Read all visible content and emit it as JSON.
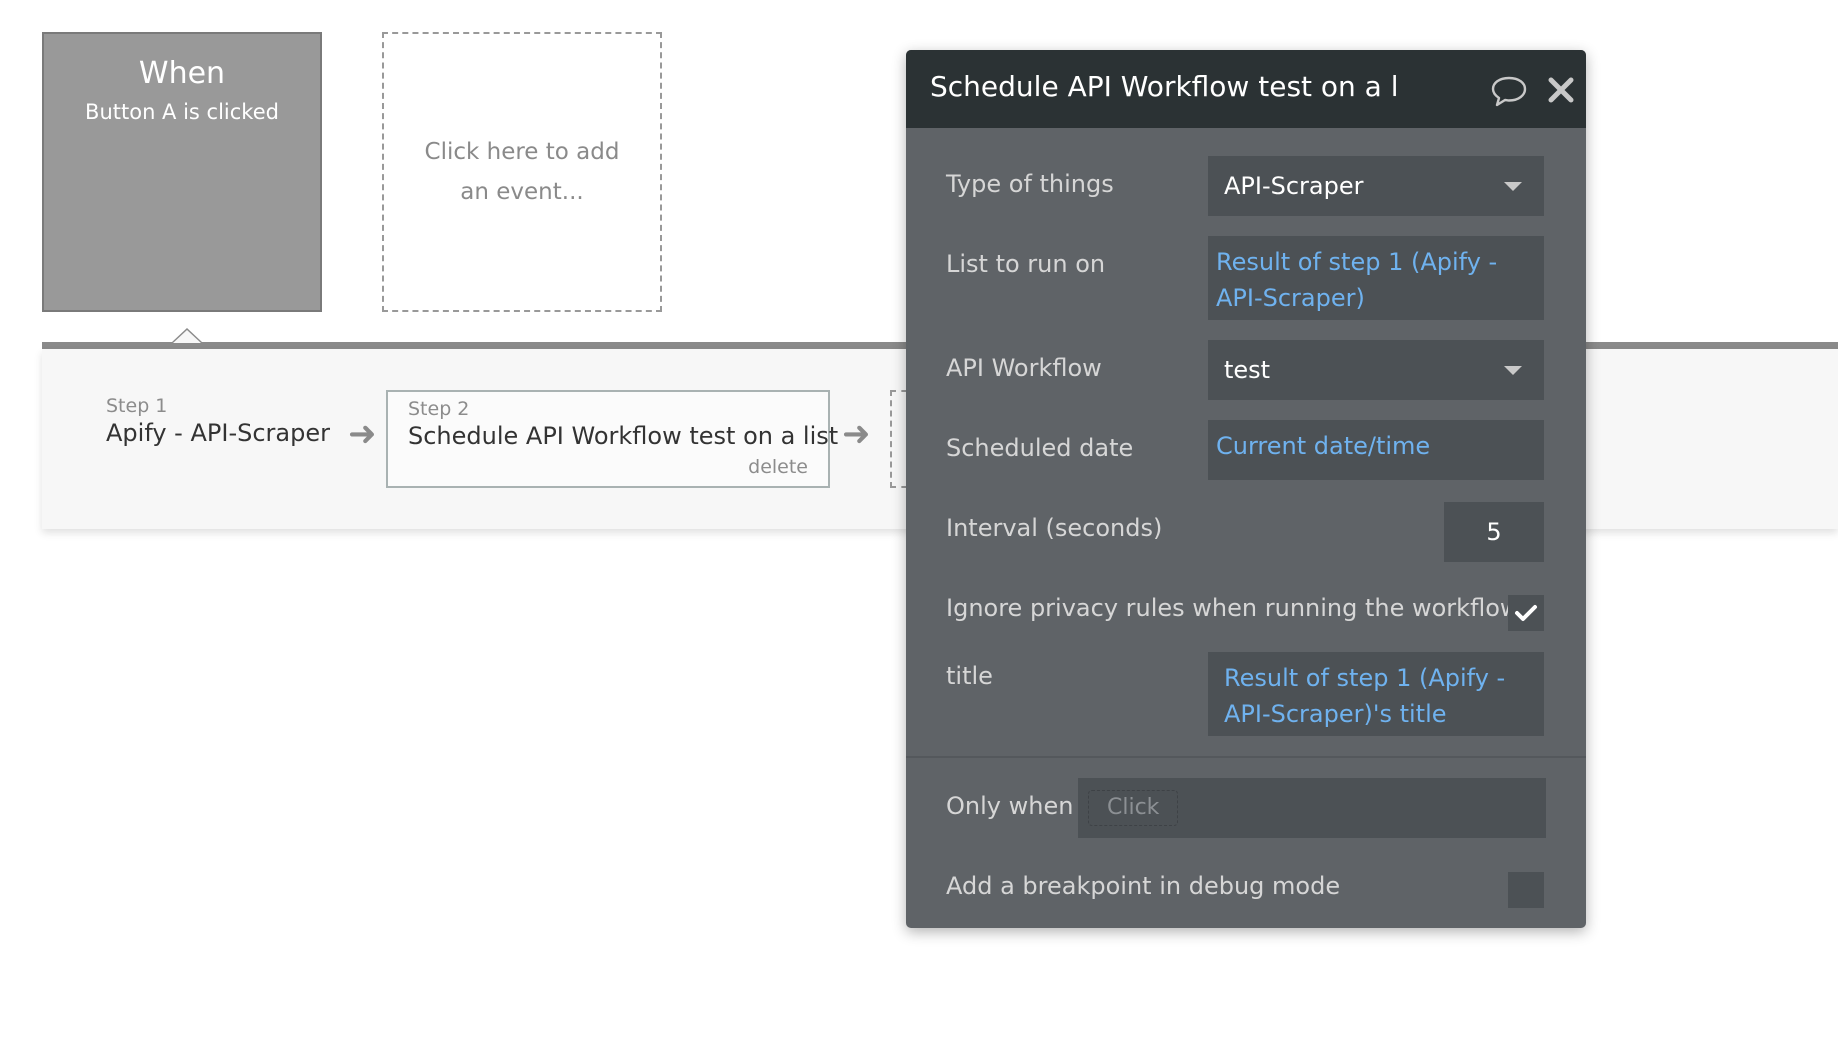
{
  "event": {
    "when_label": "When",
    "trigger_label": "Button A is clicked"
  },
  "add_event": {
    "label": "Click here to add an event..."
  },
  "steps": [
    {
      "number": "Step 1",
      "name": "Apify - API-Scraper"
    },
    {
      "number": "Step 2",
      "name": "Schedule API Workflow test on a list",
      "delete_label": "delete"
    }
  ],
  "panel": {
    "title": "Schedule API Workflow test on a l",
    "rows": {
      "type_of_things": {
        "label": "Type of things",
        "value": "API-Scraper"
      },
      "list_to_run_on": {
        "label": "List to run on",
        "value": "Result of step 1 (Apify - API-Scraper)"
      },
      "api_workflow": {
        "label": "API Workflow",
        "value": "test"
      },
      "scheduled_date": {
        "label": "Scheduled date",
        "value": "Current date/time"
      },
      "interval": {
        "label": "Interval (seconds)",
        "value": "5"
      },
      "ignore_privacy": {
        "label": "Ignore privacy rules when running the workflow",
        "checked": true
      },
      "title_param": {
        "label": "title",
        "value": "Result of step 1 (Apify - API-Scraper)'s title"
      },
      "only_when": {
        "label": "Only when",
        "placeholder": "Click"
      },
      "breakpoint": {
        "label": "Add a breakpoint in debug mode",
        "checked": false
      }
    },
    "colors": {
      "header_bg": "#2b3234",
      "panel_bg": "#5f6367",
      "field_bg": "#4c5155",
      "expression_text": "#6fb2ef"
    }
  }
}
